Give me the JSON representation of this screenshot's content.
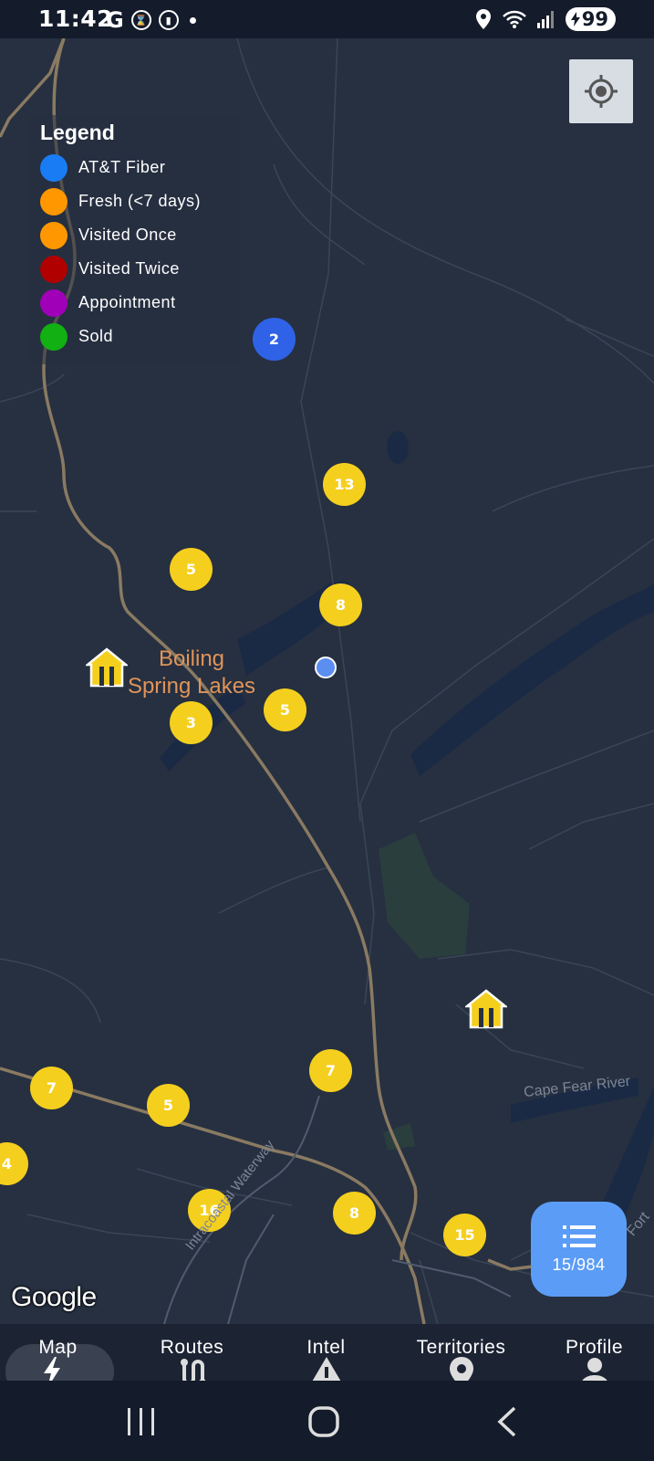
{
  "status_bar": {
    "time": "11:42",
    "g_label": "G",
    "battery": "99"
  },
  "legend": {
    "title": "Legend",
    "items": [
      {
        "label": "AT&T Fiber",
        "color": "#1a7cf5"
      },
      {
        "label": "Fresh (<7 days)",
        "color": "#ff9800"
      },
      {
        "label": "Visited Once",
        "color": "#ff9800"
      },
      {
        "label": "Visited Twice",
        "color": "#b00000"
      },
      {
        "label": "Appointment",
        "color": "#a000b8"
      },
      {
        "label": "Sold",
        "color": "#12b012"
      }
    ]
  },
  "map": {
    "place_name_line1": "Boiling",
    "place_name_line2": "Spring Lakes",
    "river_name": "Cape Fear River",
    "waterway_name": "Intracoastal Waterway",
    "fort_label": "Fort",
    "attribution": "Google",
    "clusters": [
      {
        "count": "2"
      },
      {
        "count": "13"
      },
      {
        "count": "5"
      },
      {
        "count": "8"
      },
      {
        "count": "3"
      },
      {
        "count": "5"
      },
      {
        "count": "7"
      },
      {
        "count": "7"
      },
      {
        "count": "5"
      },
      {
        "count": "4"
      },
      {
        "count": "16"
      },
      {
        "count": "8"
      },
      {
        "count": "15"
      }
    ]
  },
  "list_fab": {
    "count": "15/984"
  },
  "bottom_nav": {
    "items": [
      {
        "label": "Map"
      },
      {
        "label": "Routes"
      },
      {
        "label": "Intel"
      },
      {
        "label": "Territories"
      },
      {
        "label": "Profile"
      }
    ]
  }
}
